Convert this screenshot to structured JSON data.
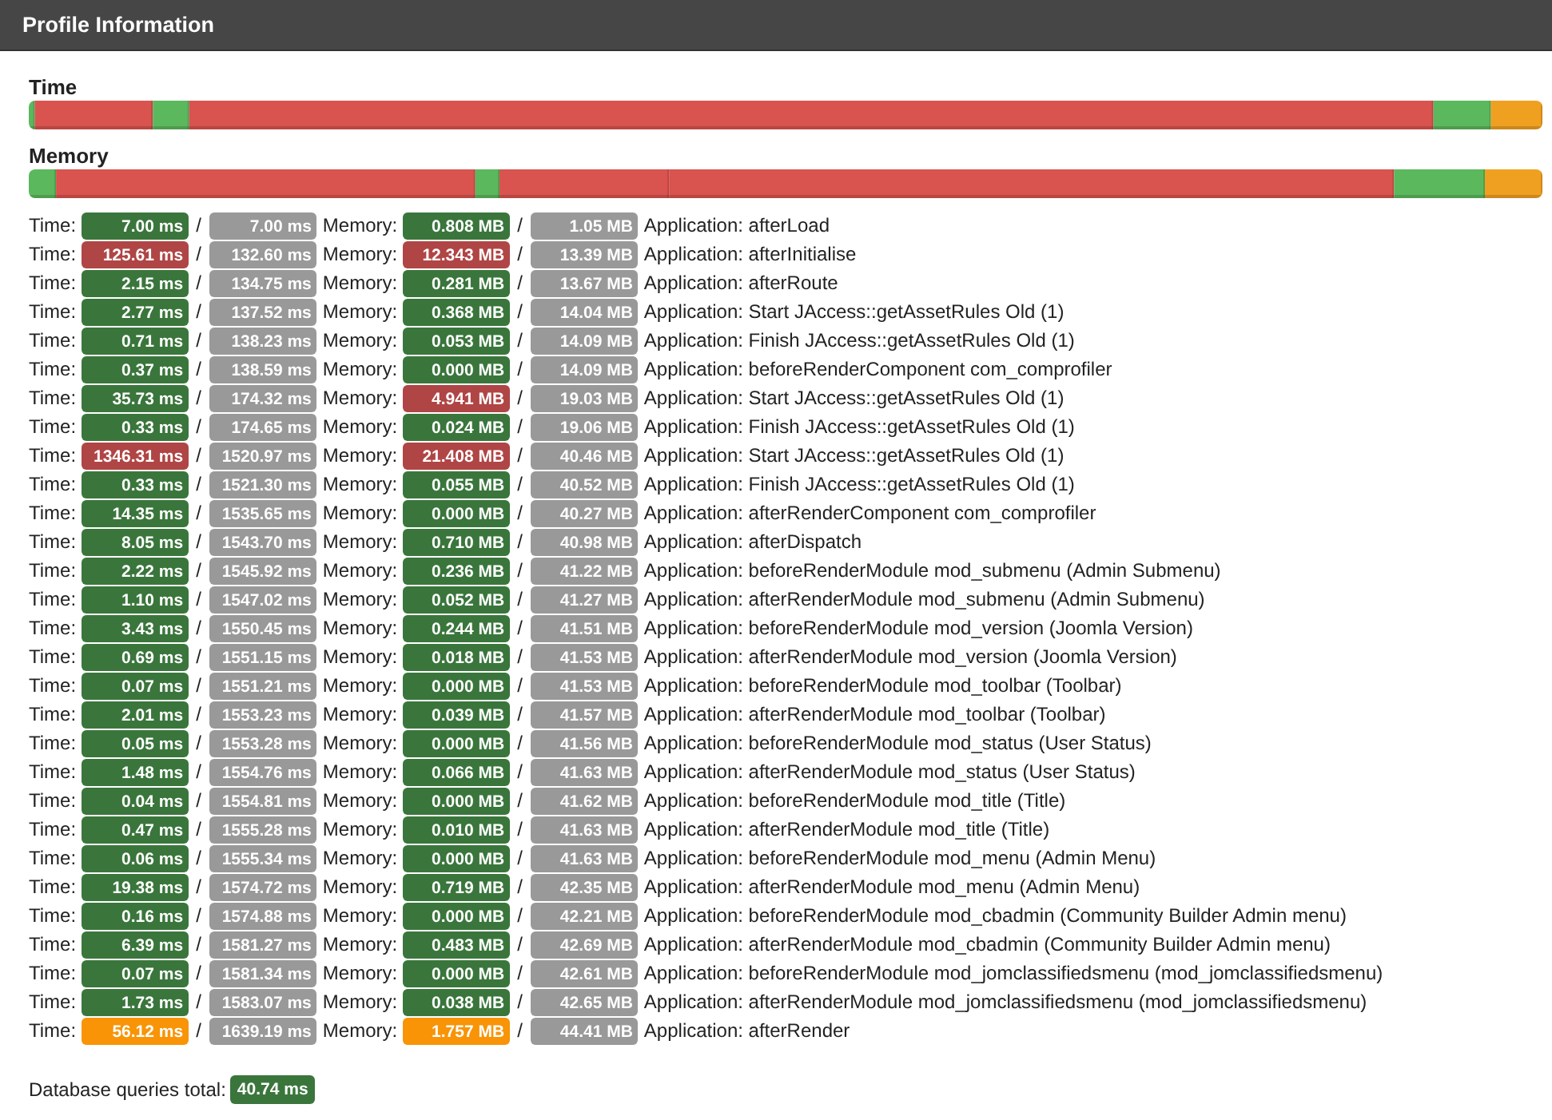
{
  "header": {
    "title": "Profile Information"
  },
  "bars": [
    {
      "label": "Time"
    },
    {
      "label": "Memory"
    }
  ],
  "rows": [
    {
      "time_label": "Time:",
      "time": {
        "text": "7.00 ms",
        "color": "#3a763c"
      },
      "time_separator": "/",
      "total_time": "7.00 ms",
      "memory_label": "Memory:",
      "memory": {
        "text": "0.808 MB",
        "color": "#3a763c"
      },
      "memory_separator": "/",
      "total_memory": "1.05 MB",
      "event": "Application: afterLoad"
    },
    {
      "time_label": "Time:",
      "time": {
        "text": "125.61 ms",
        "color": "#b04545"
      },
      "time_separator": "/",
      "total_time": "132.60 ms",
      "memory_label": "Memory:",
      "memory": {
        "text": "12.343 MB",
        "color": "#b04545"
      },
      "memory_separator": "/",
      "total_memory": "13.39 MB",
      "event": "Application: afterInitialise"
    },
    {
      "time_label": "Time:",
      "time": {
        "text": "2.15 ms",
        "color": "#3a763c"
      },
      "time_separator": "/",
      "total_time": "134.75 ms",
      "memory_label": "Memory:",
      "memory": {
        "text": "0.281 MB",
        "color": "#3a763c"
      },
      "memory_separator": "/",
      "total_memory": "13.67 MB",
      "event": "Application: afterRoute"
    },
    {
      "time_label": "Time:",
      "time": {
        "text": "2.77 ms",
        "color": "#3a763c"
      },
      "time_separator": "/",
      "total_time": "137.52 ms",
      "memory_label": "Memory:",
      "memory": {
        "text": "0.368 MB",
        "color": "#3a763c"
      },
      "memory_separator": "/",
      "total_memory": "14.04 MB",
      "event": "Application: Start JAccess::getAssetRules Old (1)"
    },
    {
      "time_label": "Time:",
      "time": {
        "text": "0.71 ms",
        "color": "#3a763c"
      },
      "time_separator": "/",
      "total_time": "138.23 ms",
      "memory_label": "Memory:",
      "memory": {
        "text": "0.053 MB",
        "color": "#3a763c"
      },
      "memory_separator": "/",
      "total_memory": "14.09 MB",
      "event": "Application: Finish JAccess::getAssetRules Old (1)"
    },
    {
      "time_label": "Time:",
      "time": {
        "text": "0.37 ms",
        "color": "#3a763c"
      },
      "time_separator": "/",
      "total_time": "138.59 ms",
      "memory_label": "Memory:",
      "memory": {
        "text": "0.000 MB",
        "color": "#3a763c"
      },
      "memory_separator": "/",
      "total_memory": "14.09 MB",
      "event": "Application: beforeRenderComponent com_comprofiler"
    },
    {
      "time_label": "Time:",
      "time": {
        "text": "35.73 ms",
        "color": "#3a763c"
      },
      "time_separator": "/",
      "total_time": "174.32 ms",
      "memory_label": "Memory:",
      "memory": {
        "text": "4.941 MB",
        "color": "#b04545"
      },
      "memory_separator": "/",
      "total_memory": "19.03 MB",
      "event": "Application: Start JAccess::getAssetRules Old (1)"
    },
    {
      "time_label": "Time:",
      "time": {
        "text": "0.33 ms",
        "color": "#3a763c"
      },
      "time_separator": "/",
      "total_time": "174.65 ms",
      "memory_label": "Memory:",
      "memory": {
        "text": "0.024 MB",
        "color": "#3a763c"
      },
      "memory_separator": "/",
      "total_memory": "19.06 MB",
      "event": "Application: Finish JAccess::getAssetRules Old (1)"
    },
    {
      "time_label": "Time:",
      "time": {
        "text": "1346.31 ms",
        "color": "#b04545"
      },
      "time_separator": "/",
      "total_time": "1520.97 ms",
      "memory_label": "Memory:",
      "memory": {
        "text": "21.408 MB",
        "color": "#b04545"
      },
      "memory_separator": "/",
      "total_memory": "40.46 MB",
      "event": "Application: Start JAccess::getAssetRules Old (1)"
    },
    {
      "time_label": "Time:",
      "time": {
        "text": "0.33 ms",
        "color": "#3a763c"
      },
      "time_separator": "/",
      "total_time": "1521.30 ms",
      "memory_label": "Memory:",
      "memory": {
        "text": "0.055 MB",
        "color": "#3a763c"
      },
      "memory_separator": "/",
      "total_memory": "40.52 MB",
      "event": "Application: Finish JAccess::getAssetRules Old (1)"
    },
    {
      "time_label": "Time:",
      "time": {
        "text": "14.35 ms",
        "color": "#3a763c"
      },
      "time_separator": "/",
      "total_time": "1535.65 ms",
      "memory_label": "Memory:",
      "memory": {
        "text": "0.000 MB",
        "color": "#3a763c"
      },
      "memory_separator": "/",
      "total_memory": "40.27 MB",
      "event": "Application: afterRenderComponent com_comprofiler"
    },
    {
      "time_label": "Time:",
      "time": {
        "text": "8.05 ms",
        "color": "#3a763c"
      },
      "time_separator": "/",
      "total_time": "1543.70 ms",
      "memory_label": "Memory:",
      "memory": {
        "text": "0.710 MB",
        "color": "#3a763c"
      },
      "memory_separator": "/",
      "total_memory": "40.98 MB",
      "event": "Application: afterDispatch"
    },
    {
      "time_label": "Time:",
      "time": {
        "text": "2.22 ms",
        "color": "#3a763c"
      },
      "time_separator": "/",
      "total_time": "1545.92 ms",
      "memory_label": "Memory:",
      "memory": {
        "text": "0.236 MB",
        "color": "#3a763c"
      },
      "memory_separator": "/",
      "total_memory": "41.22 MB",
      "event": "Application: beforeRenderModule mod_submenu (Admin Submenu)"
    },
    {
      "time_label": "Time:",
      "time": {
        "text": "1.10 ms",
        "color": "#3a763c"
      },
      "time_separator": "/",
      "total_time": "1547.02 ms",
      "memory_label": "Memory:",
      "memory": {
        "text": "0.052 MB",
        "color": "#3a763c"
      },
      "memory_separator": "/",
      "total_memory": "41.27 MB",
      "event": "Application: afterRenderModule mod_submenu (Admin Submenu)"
    },
    {
      "time_label": "Time:",
      "time": {
        "text": "3.43 ms",
        "color": "#3a763c"
      },
      "time_separator": "/",
      "total_time": "1550.45 ms",
      "memory_label": "Memory:",
      "memory": {
        "text": "0.244 MB",
        "color": "#3a763c"
      },
      "memory_separator": "/",
      "total_memory": "41.51 MB",
      "event": "Application: beforeRenderModule mod_version (Joomla Version)"
    },
    {
      "time_label": "Time:",
      "time": {
        "text": "0.69 ms",
        "color": "#3a763c"
      },
      "time_separator": "/",
      "total_time": "1551.15 ms",
      "memory_label": "Memory:",
      "memory": {
        "text": "0.018 MB",
        "color": "#3a763c"
      },
      "memory_separator": "/",
      "total_memory": "41.53 MB",
      "event": "Application: afterRenderModule mod_version (Joomla Version)"
    },
    {
      "time_label": "Time:",
      "time": {
        "text": "0.07 ms",
        "color": "#3a763c"
      },
      "time_separator": "/",
      "total_time": "1551.21 ms",
      "memory_label": "Memory:",
      "memory": {
        "text": "0.000 MB",
        "color": "#3a763c"
      },
      "memory_separator": "/",
      "total_memory": "41.53 MB",
      "event": "Application: beforeRenderModule mod_toolbar (Toolbar)"
    },
    {
      "time_label": "Time:",
      "time": {
        "text": "2.01 ms",
        "color": "#3a763c"
      },
      "time_separator": "/",
      "total_time": "1553.23 ms",
      "memory_label": "Memory:",
      "memory": {
        "text": "0.039 MB",
        "color": "#3a763c"
      },
      "memory_separator": "/",
      "total_memory": "41.57 MB",
      "event": "Application: afterRenderModule mod_toolbar (Toolbar)"
    },
    {
      "time_label": "Time:",
      "time": {
        "text": "0.05 ms",
        "color": "#3a763c"
      },
      "time_separator": "/",
      "total_time": "1553.28 ms",
      "memory_label": "Memory:",
      "memory": {
        "text": "0.000 MB",
        "color": "#3a763c"
      },
      "memory_separator": "/",
      "total_memory": "41.56 MB",
      "event": "Application: beforeRenderModule mod_status (User Status)"
    },
    {
      "time_label": "Time:",
      "time": {
        "text": "1.48 ms",
        "color": "#3a763c"
      },
      "time_separator": "/",
      "total_time": "1554.76 ms",
      "memory_label": "Memory:",
      "memory": {
        "text": "0.066 MB",
        "color": "#3a763c"
      },
      "memory_separator": "/",
      "total_memory": "41.63 MB",
      "event": "Application: afterRenderModule mod_status (User Status)"
    },
    {
      "time_label": "Time:",
      "time": {
        "text": "0.04 ms",
        "color": "#3a763c"
      },
      "time_separator": "/",
      "total_time": "1554.81 ms",
      "memory_label": "Memory:",
      "memory": {
        "text": "0.000 MB",
        "color": "#3a763c"
      },
      "memory_separator": "/",
      "total_memory": "41.62 MB",
      "event": "Application: beforeRenderModule mod_title (Title)"
    },
    {
      "time_label": "Time:",
      "time": {
        "text": "0.47 ms",
        "color": "#3a763c"
      },
      "time_separator": "/",
      "total_time": "1555.28 ms",
      "memory_label": "Memory:",
      "memory": {
        "text": "0.010 MB",
        "color": "#3a763c"
      },
      "memory_separator": "/",
      "total_memory": "41.63 MB",
      "event": "Application: afterRenderModule mod_title (Title)"
    },
    {
      "time_label": "Time:",
      "time": {
        "text": "0.06 ms",
        "color": "#3a763c"
      },
      "time_separator": "/",
      "total_time": "1555.34 ms",
      "memory_label": "Memory:",
      "memory": {
        "text": "0.000 MB",
        "color": "#3a763c"
      },
      "memory_separator": "/",
      "total_memory": "41.63 MB",
      "event": "Application: beforeRenderModule mod_menu (Admin Menu)"
    },
    {
      "time_label": "Time:",
      "time": {
        "text": "19.38 ms",
        "color": "#3a763c"
      },
      "time_separator": "/",
      "total_time": "1574.72 ms",
      "memory_label": "Memory:",
      "memory": {
        "text": "0.719 MB",
        "color": "#3a763c"
      },
      "memory_separator": "/",
      "total_memory": "42.35 MB",
      "event": "Application: afterRenderModule mod_menu (Admin Menu)"
    },
    {
      "time_label": "Time:",
      "time": {
        "text": "0.16 ms",
        "color": "#3a763c"
      },
      "time_separator": "/",
      "total_time": "1574.88 ms",
      "memory_label": "Memory:",
      "memory": {
        "text": "0.000 MB",
        "color": "#3a763c"
      },
      "memory_separator": "/",
      "total_memory": "42.21 MB",
      "event": "Application: beforeRenderModule mod_cbadmin (Community Builder Admin menu)"
    },
    {
      "time_label": "Time:",
      "time": {
        "text": "6.39 ms",
        "color": "#3a763c"
      },
      "time_separator": "/",
      "total_time": "1581.27 ms",
      "memory_label": "Memory:",
      "memory": {
        "text": "0.483 MB",
        "color": "#3a763c"
      },
      "memory_separator": "/",
      "total_memory": "42.69 MB",
      "event": "Application: afterRenderModule mod_cbadmin (Community Builder Admin menu)"
    },
    {
      "time_label": "Time:",
      "time": {
        "text": "0.07 ms",
        "color": "#3a763c"
      },
      "time_separator": "/",
      "total_time": "1581.34 ms",
      "memory_label": "Memory:",
      "memory": {
        "text": "0.000 MB",
        "color": "#3a763c"
      },
      "memory_separator": "/",
      "total_memory": "42.61 MB",
      "event": "Application: beforeRenderModule mod_jomclassifiedsmenu (mod_jomclassifiedsmenu)"
    },
    {
      "time_label": "Time:",
      "time": {
        "text": "1.73 ms",
        "color": "#3a763c"
      },
      "time_separator": "/",
      "total_time": "1583.07 ms",
      "memory_label": "Memory:",
      "memory": {
        "text": "0.038 MB",
        "color": "#3a763c"
      },
      "memory_separator": "/",
      "total_memory": "42.65 MB",
      "event": "Application: afterRenderModule mod_jomclassifiedsmenu (mod_jomclassifiedsmenu)"
    },
    {
      "time_label": "Time:",
      "time": {
        "text": "56.12 ms",
        "color": "#f89406"
      },
      "time_separator": "/",
      "total_time": "1639.19 ms",
      "memory_label": "Memory:",
      "memory": {
        "text": "1.757 MB",
        "color": "#f89406"
      },
      "memory_separator": "/",
      "total_memory": "44.41 MB",
      "event": "Application: afterRender"
    }
  ],
  "db_total": {
    "label": "Database queries total:",
    "value": "40.74 ms"
  }
}
